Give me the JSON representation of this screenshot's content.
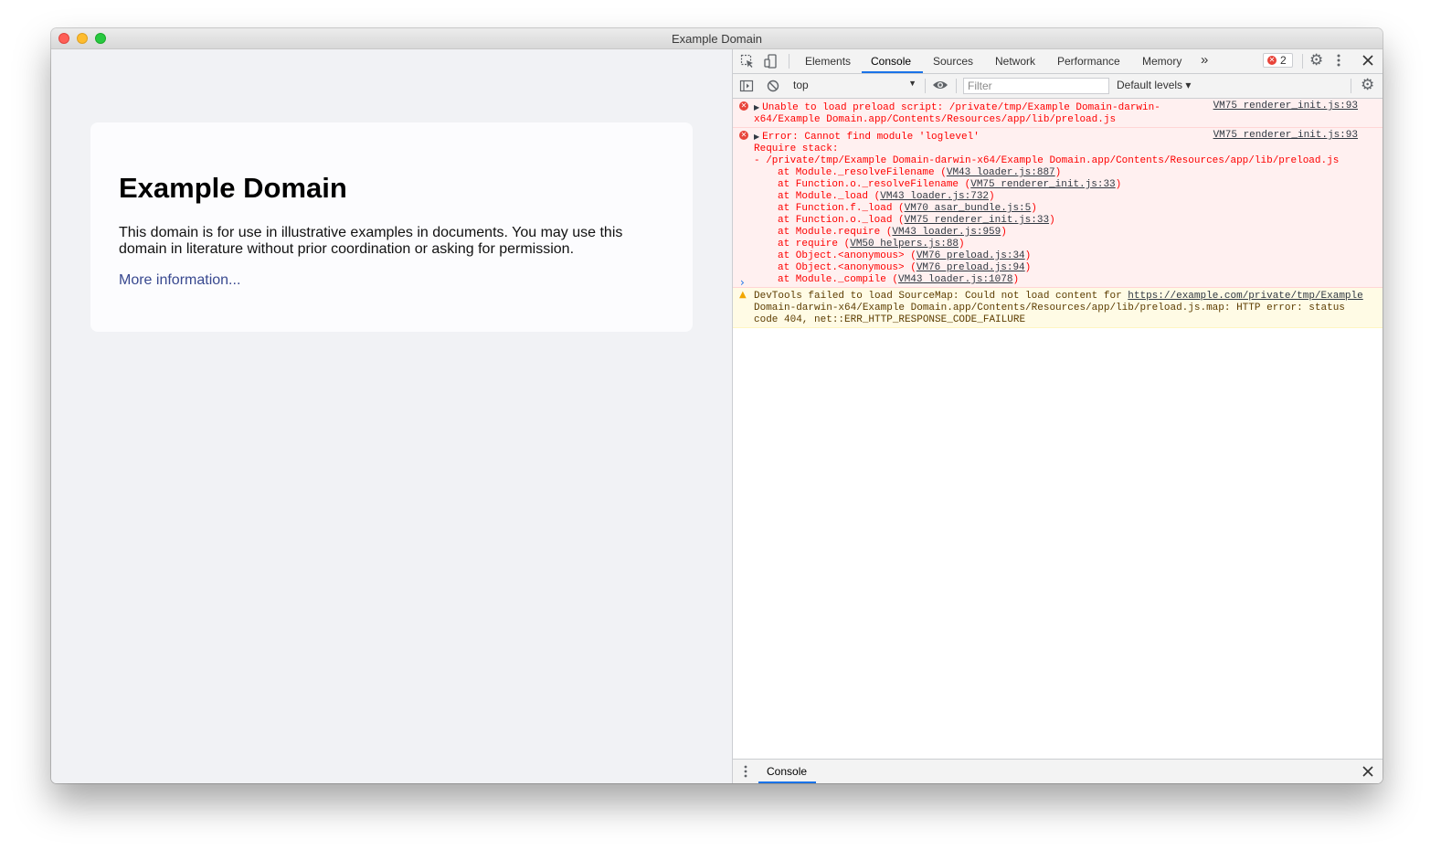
{
  "window": {
    "title": "Example Domain"
  },
  "page": {
    "heading": "Example Domain",
    "description": "This domain is for use in illustrative examples in documents. You may use this domain in literature without prior coordination or asking for permission.",
    "link": "More information..."
  },
  "devtools": {
    "tabs": [
      "Elements",
      "Console",
      "Sources",
      "Network",
      "Performance",
      "Memory"
    ],
    "active_tab": "Console",
    "more_tabs": "»",
    "error_count": "2",
    "toolbar": {
      "context": "top",
      "filter_placeholder": "Filter",
      "levels": "Default levels ▾"
    },
    "messages": {
      "m1": {
        "line1": "Unable to load preload script: /private/tmp/Example Domain-darwin-",
        "line2": "x64/Example Domain.app/Contents/Resources/app/lib/preload.js",
        "source": "VM75 renderer_init.js:93"
      },
      "m2": {
        "line1": "Error: Cannot find module 'loglevel'",
        "line2": "Require stack:",
        "line3": "- /private/tmp/Example Domain-darwin-x64/Example Domain.app/Contents/Resources/app/lib/preload.js",
        "source": "VM75 renderer_init.js:93",
        "stack": [
          {
            "fn": "at Module._resolveFilename (",
            "link": "VM43 loader.js:887",
            "end": ")"
          },
          {
            "fn": "at Function.o._resolveFilename (",
            "link": "VM75 renderer_init.js:33",
            "end": ")"
          },
          {
            "fn": "at Module._load (",
            "link": "VM43 loader.js:732",
            "end": ")"
          },
          {
            "fn": "at Function.f._load (",
            "link": "VM70 asar_bundle.js:5",
            "end": ")"
          },
          {
            "fn": "at Function.o._load (",
            "link": "VM75 renderer_init.js:33",
            "end": ")"
          },
          {
            "fn": "at Module.require (",
            "link": "VM43 loader.js:959",
            "end": ")"
          },
          {
            "fn": "at require (",
            "link": "VM50 helpers.js:88",
            "end": ")"
          },
          {
            "fn": "at Object.<anonymous> (",
            "link": "VM76 preload.js:34",
            "end": ")"
          },
          {
            "fn": "at Object.<anonymous> (",
            "link": "VM76 preload.js:94",
            "end": ")"
          },
          {
            "fn": "at Module._compile (",
            "link": "VM43 loader.js:1078",
            "end": ")"
          }
        ]
      },
      "m3": {
        "prefix": "DevTools failed to load SourceMap: Could not load content for ",
        "url": "https://example.com/private/tmp/Example",
        "line2": "Domain-darwin-x64/Example Domain.app/Contents/Resources/app/lib/preload.js.map: HTTP error: status",
        "line3": "code 404, net::ERR_HTTP_RESPONSE_CODE_FAILURE"
      }
    },
    "drawer": {
      "tab": "Console"
    }
  },
  "colors": {
    "error": "#fe0000",
    "accent": "#1a73e8",
    "link": "#38488f"
  },
  "icons": [
    "inspect-icon",
    "device-toggle-icon",
    "settings-icon",
    "more-vert-icon",
    "close-icon",
    "sidebar-toggle-icon",
    "clear-console-icon",
    "eye-icon",
    "error-icon",
    "warning-icon"
  ]
}
